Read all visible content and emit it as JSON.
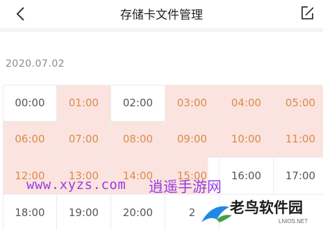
{
  "header": {
    "title": "存储卡文件管理"
  },
  "date_label": "2020.07.02",
  "time_slots": [
    {
      "label": "00:00",
      "recorded": false
    },
    {
      "label": "01:00",
      "recorded": true
    },
    {
      "label": "02:00",
      "recorded": false
    },
    {
      "label": "03:00",
      "recorded": true
    },
    {
      "label": "04:00",
      "recorded": true
    },
    {
      "label": "05:00",
      "recorded": true
    },
    {
      "label": "06:00",
      "recorded": true
    },
    {
      "label": "07:00",
      "recorded": true
    },
    {
      "label": "08:00",
      "recorded": true
    },
    {
      "label": "09:00",
      "recorded": true
    },
    {
      "label": "10:00",
      "recorded": true
    },
    {
      "label": "11:00",
      "recorded": true
    },
    {
      "label": "12:00",
      "recorded": true
    },
    {
      "label": "13:00",
      "recorded": true
    },
    {
      "label": "14:00",
      "recorded": true
    },
    {
      "label": "15:00",
      "recorded": "partial"
    },
    {
      "label": "16:00",
      "recorded": false
    },
    {
      "label": "17:00",
      "recorded": false
    },
    {
      "label": "18:00",
      "recorded": false
    },
    {
      "label": "19:00",
      "recorded": false
    },
    {
      "label": "20:00",
      "recorded": false
    },
    {
      "label": "2",
      "recorded": false
    }
  ],
  "watermark": {
    "url": "www.xyzs.com",
    "cn": "逍遥手游网"
  },
  "logo": {
    "name": "老鸟软件园",
    "sub": "LNIOS.NET"
  },
  "colors": {
    "recorded_bg": "#fbe3df",
    "recorded_text": "#d98b4a",
    "watermark": "#8a2be2"
  },
  "icons": {
    "back": "chevron-left-icon",
    "edit": "edit-icon"
  }
}
